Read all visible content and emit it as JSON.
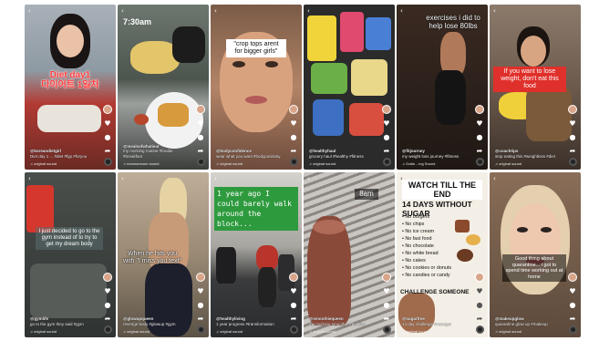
{
  "tiles": [
    {
      "overlay": "Diet day1\n다이어트 1일차",
      "caption_user": "@koreandietgirl",
      "caption_text": "Diet day 1 ... #diet #fyp #foryou",
      "music": "♫ original sound"
    },
    {
      "time": "7:30am",
      "caption_user": "@mealsofwhatieat",
      "caption_text": "my morning routine #foodie #breakfast",
      "music": "♫ nomnomnom sound"
    },
    {
      "overlay": "\"crop tops arent for bigger girls\"",
      "caption_user": "@bodyconfidence",
      "caption_text": "wear what you want #bodypositivity",
      "music": "♫ original sound"
    },
    {
      "caption_user": "@healthyhaul",
      "caption_text": "grocery haul #healthy #fitness",
      "music": "♫ original sound"
    },
    {
      "overlay": "exercises i did to help lose 80lbs",
      "caption_user": "@fitjourney",
      "caption_text": "my weight loss journey #fitness",
      "music": "♫ Gotta ...ing Sound"
    },
    {
      "overlay": "If you want to lose weight, don't eat this food",
      "caption_user": "@coachtips",
      "caption_text": "stop eating this #weightloss #diet",
      "music": "♫ original sound"
    },
    {
      "overlay": "I just decided to go to the gym instead of to try to get my dream body",
      "caption_user": "@gymlife",
      "caption_text": "go to the gym they said #gym",
      "music": "♫ original sound"
    },
    {
      "overlay": "When he hits you with \"I miss you text\"",
      "caption_user": "@glowupqueen",
      "caption_text": "revenge body #glowup #gym",
      "music": "♫ original sound"
    },
    {
      "overlay": "1 year ago I could barely walk around the block...",
      "caption_user": "@healthyliving",
      "caption_text": "1 year progress #transformation",
      "music": "♫ original sound"
    },
    {
      "overlay": "8am",
      "caption_user": "@smoothiequeen",
      "caption_text": "my morning smoothie #healthy",
      "music": "♫ original sound"
    },
    {
      "poster_head": "WATCH TILL THE END",
      "poster_title": "14 DAYS WITHOUT SUGAR",
      "poster_items": [
        "No burgers",
        "No chips",
        "No ice cream",
        "No fast food",
        "No chocolate",
        "No white bread",
        "No cakes",
        "No cookies or donuts",
        "No candies or candy"
      ],
      "poster_challenge": "CHALLENGE SOMEONE",
      "caption_user": "@sugarfree",
      "caption_text": "14 day challenge #nosugar",
      "music": "♫ original sound"
    },
    {
      "overlay": "Good thing about quarantine... i got to spend time working out at home",
      "caption_user": "@makeupglow",
      "caption_text": "quarantine glow up #makeup",
      "music": "♫ original sound"
    }
  ],
  "icons": {
    "heart": "heart-icon",
    "comment": "comment-icon",
    "share": "share-icon",
    "back": "back-icon",
    "disc": "music-disc-icon"
  }
}
